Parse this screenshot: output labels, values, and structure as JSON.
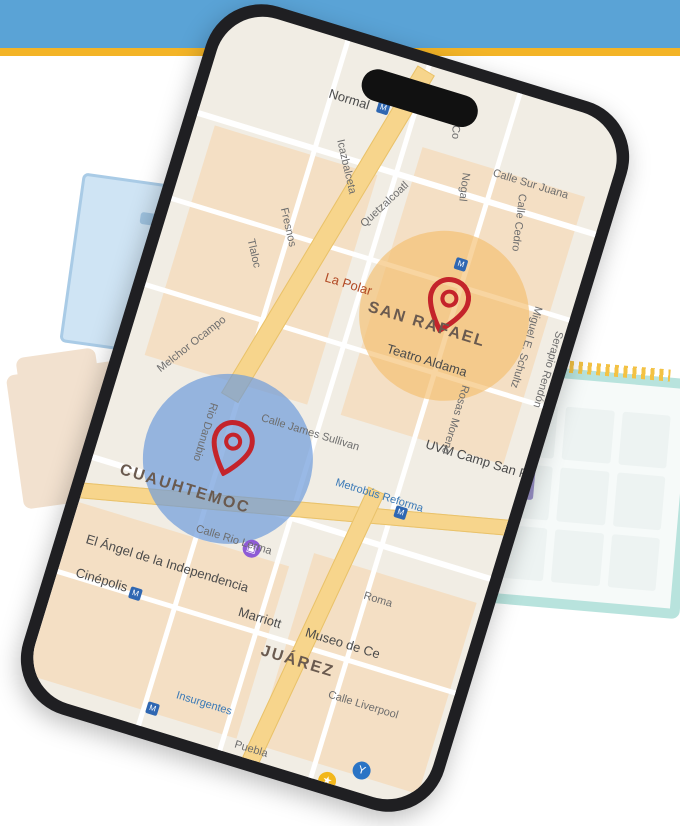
{
  "map": {
    "districts": {
      "san_rafael": "SAN RAFAEL",
      "cuauhtemoc": "CUAUHTEMOC",
      "juarez": "JUÁREZ"
    },
    "labels": {
      "normal": "Normal",
      "la_polar": "La Polar",
      "teatro": "Teatro Aldama",
      "uvm": "UVM Camp San Rafa",
      "angel": "El Ángel de la Independencia",
      "cinepolis": "Cinépolis",
      "marriott": "Marriott",
      "museo": "Museo de Ce",
      "metro_reforma": "Metrobús Reforma",
      "insurgentes": "Insurgentes",
      "puebla": "Puebla",
      "roma": "Roma"
    },
    "streets": {
      "calle_sur_juana": "Calle Sur Juana",
      "melchor": "Melchor Ocampo",
      "james": "Calle James Sullivan",
      "rio_lerma": "Calle Rio Lerma",
      "liverpool": "Calle Liverpool",
      "rio_danubio": "Rio Danubio",
      "rosas": "Rosas Moreno",
      "miguel": "Miguel E. Schultz",
      "icazbalceta": "Icazbalceta",
      "quetzalcoatl": "Quetzalcoatl",
      "tlaloc": "Tlaloc",
      "fenix": "Fresnos",
      "serapio": "Serapio Rendón",
      "nogal": "Nogal",
      "cedro": "Calle Cedro",
      "copito": "Co"
    },
    "colors": {
      "pin_red": "#c4242b",
      "zone_orange": "#f4be6e",
      "zone_blue": "#6e9bdc"
    }
  }
}
